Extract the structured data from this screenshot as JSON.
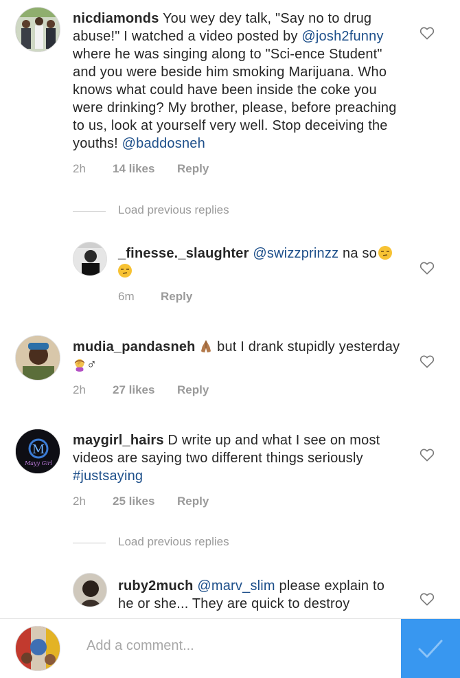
{
  "comments": [
    {
      "username": "nicdiamonds",
      "text_1": " You wey dey talk, \"Say no to drug abuse!\" I watched a video posted by ",
      "mention_1": "@josh2funny",
      "text_2": " where he was singing along to \"Sci-ence Student\" and you were beside him smoking Marijuana. Who knows what could have been inside the coke you were drinking? My brother, please, before preaching to us, look at yourself very well. Stop deceiving the youths! ",
      "mention_2": "@baddosneh",
      "time": "2h",
      "likes": "14 likes",
      "reply": "Reply"
    },
    {
      "username": "mudia_pandasneh",
      "text_1": " but I drank stupidly yesterday ",
      "text_2": "♂",
      "time": "2h",
      "likes": "27 likes",
      "reply": "Reply"
    },
    {
      "username": "maygirl_hairs",
      "text_1": " D write up and what I see on most videos are saying two different things seriously ",
      "hashtag": "#justsaying",
      "time": "2h",
      "likes": "25 likes",
      "reply": "Reply"
    }
  ],
  "replies": [
    {
      "username": "_finesse._slaughter",
      "mention": "@swizzprinzz",
      "text": " na so",
      "time": "6m",
      "reply": "Reply"
    },
    {
      "username": "ruby2much",
      "mention": "@marv_slim",
      "text": " please explain to he or she... They are quick to destroy"
    }
  ],
  "load_previous": "Load previous replies",
  "composer": {
    "placeholder": "Add a comment..."
  },
  "colors": {
    "mention": "#1d4f8a",
    "meta": "#9a9a9a",
    "send_button": "#3897f0"
  },
  "icons": [
    "heart-outline-icon",
    "checkmark-icon",
    "folded-hands-emoji",
    "unamused-face-emoji",
    "woman-facepalming-emoji"
  ]
}
